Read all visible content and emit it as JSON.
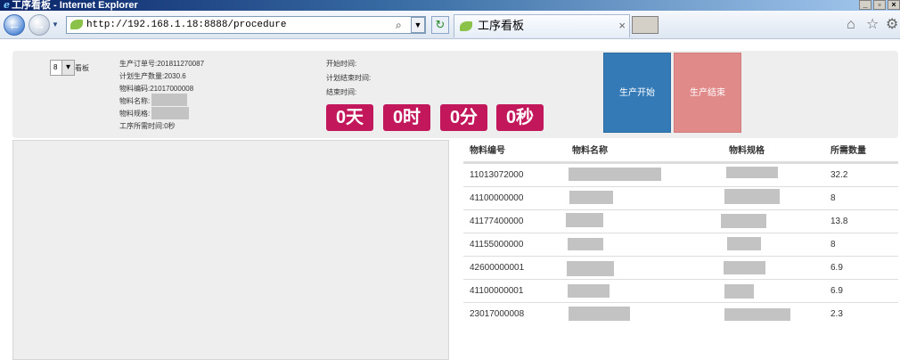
{
  "browser": {
    "window_title": "工序看板 - Internet Explorer",
    "address": "http://192.168.1.18:8888/procedure",
    "tab_title": "工序看板"
  },
  "header": {
    "select_value": "8",
    "select_label": "看板",
    "order_no": "生产订单号:201811270087",
    "plan_qty": "计划生产数量:2030.6",
    "material_code": "物料编码:21017000008",
    "material_name": "物料名称:",
    "material_spec": "物料规格:",
    "required_time": "工序所需时间:0秒",
    "start_time": "开始时间:",
    "plan_end_time": "计划结束时间:",
    "end_time": "结束时间:",
    "days": "0天",
    "hours": "0时",
    "minutes": "0分",
    "seconds": "0秒",
    "start_button": "生产开始",
    "end_button": "生产结束"
  },
  "table": {
    "columns": [
      "物料编号",
      "物料名称",
      "物料规格",
      "所需数量"
    ],
    "rows": [
      {
        "code": "11013072000",
        "qty": "32.2"
      },
      {
        "code": "41100000000",
        "qty": "8"
      },
      {
        "code": "41177400000",
        "qty": "13.8"
      },
      {
        "code": "41155000000",
        "qty": "8"
      },
      {
        "code": "42600000001",
        "qty": "6.9"
      },
      {
        "code": "41100000001",
        "qty": "6.9"
      },
      {
        "code": "23017000008",
        "qty": "2.3"
      }
    ]
  },
  "colors": {
    "time_box": "#c2185b",
    "start_button": "#337ab7",
    "end_button": "#e18a8a",
    "redaction": "#c3c3c3"
  }
}
